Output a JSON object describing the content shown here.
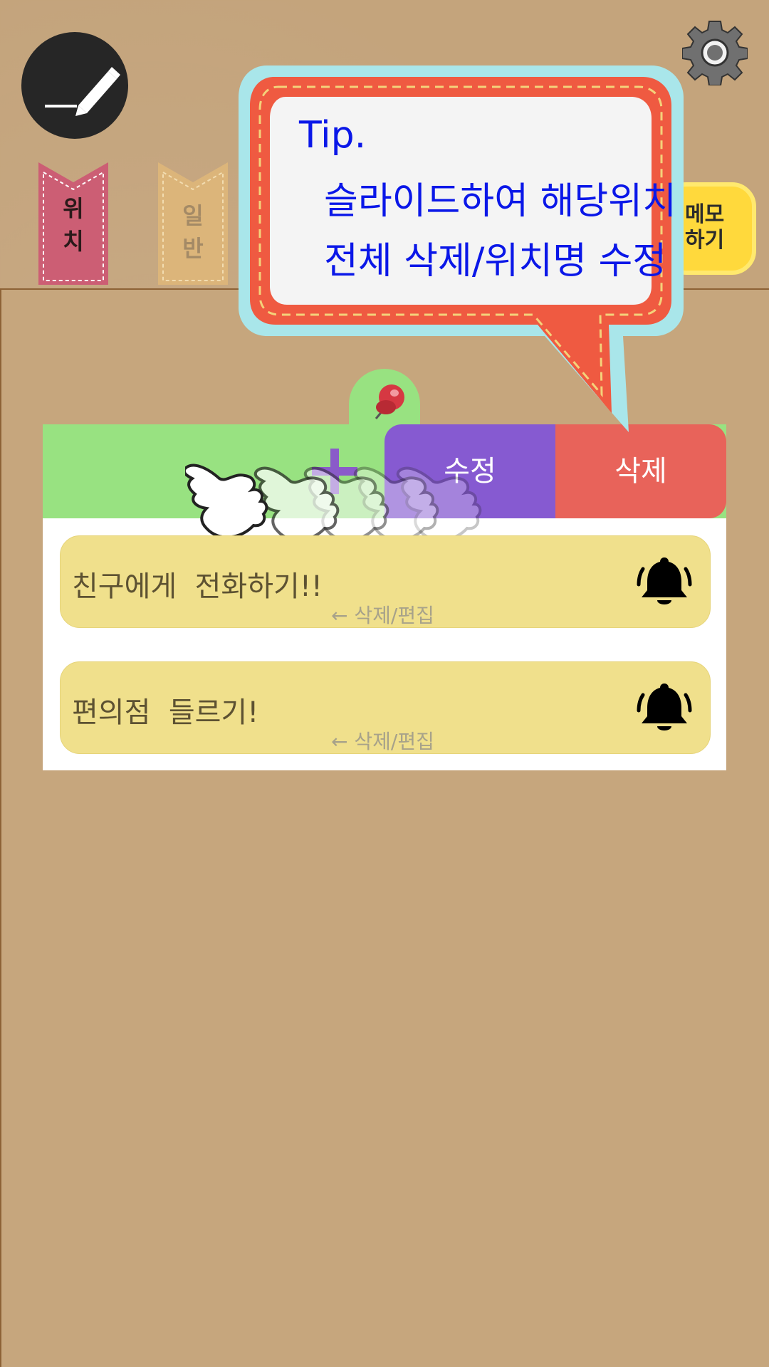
{
  "toolbar": {
    "compose_icon": "compose-pen-icon",
    "settings_icon": "gear-icon"
  },
  "tabs": [
    {
      "label": "위\n치",
      "color": "#cc5e74"
    },
    {
      "label": "일\n반",
      "color": "#dcb57a"
    }
  ],
  "memo_button": {
    "label": "메모\n하기"
  },
  "tip": {
    "title": "Tip.",
    "line1": "슬라이드하여 해당위치",
    "line2": "전체 삭제/위치명 수정"
  },
  "location_card": {
    "header_color": "#98e281",
    "add_icon": "plus-icon",
    "edit_label": "수정",
    "delete_label": "삭제",
    "items": [
      {
        "text": "친구에게  전화하기!!",
        "hint": "← 삭제/편집",
        "icon": "bell-icon"
      },
      {
        "text": "편의점  들르기!",
        "hint": "← 삭제/편집",
        "icon": "bell-icon"
      }
    ]
  },
  "colors": {
    "edit": "#865ad1",
    "delete": "#e8635a",
    "memo_item": "#f0e08c",
    "tip_text": "#0a17e8"
  }
}
